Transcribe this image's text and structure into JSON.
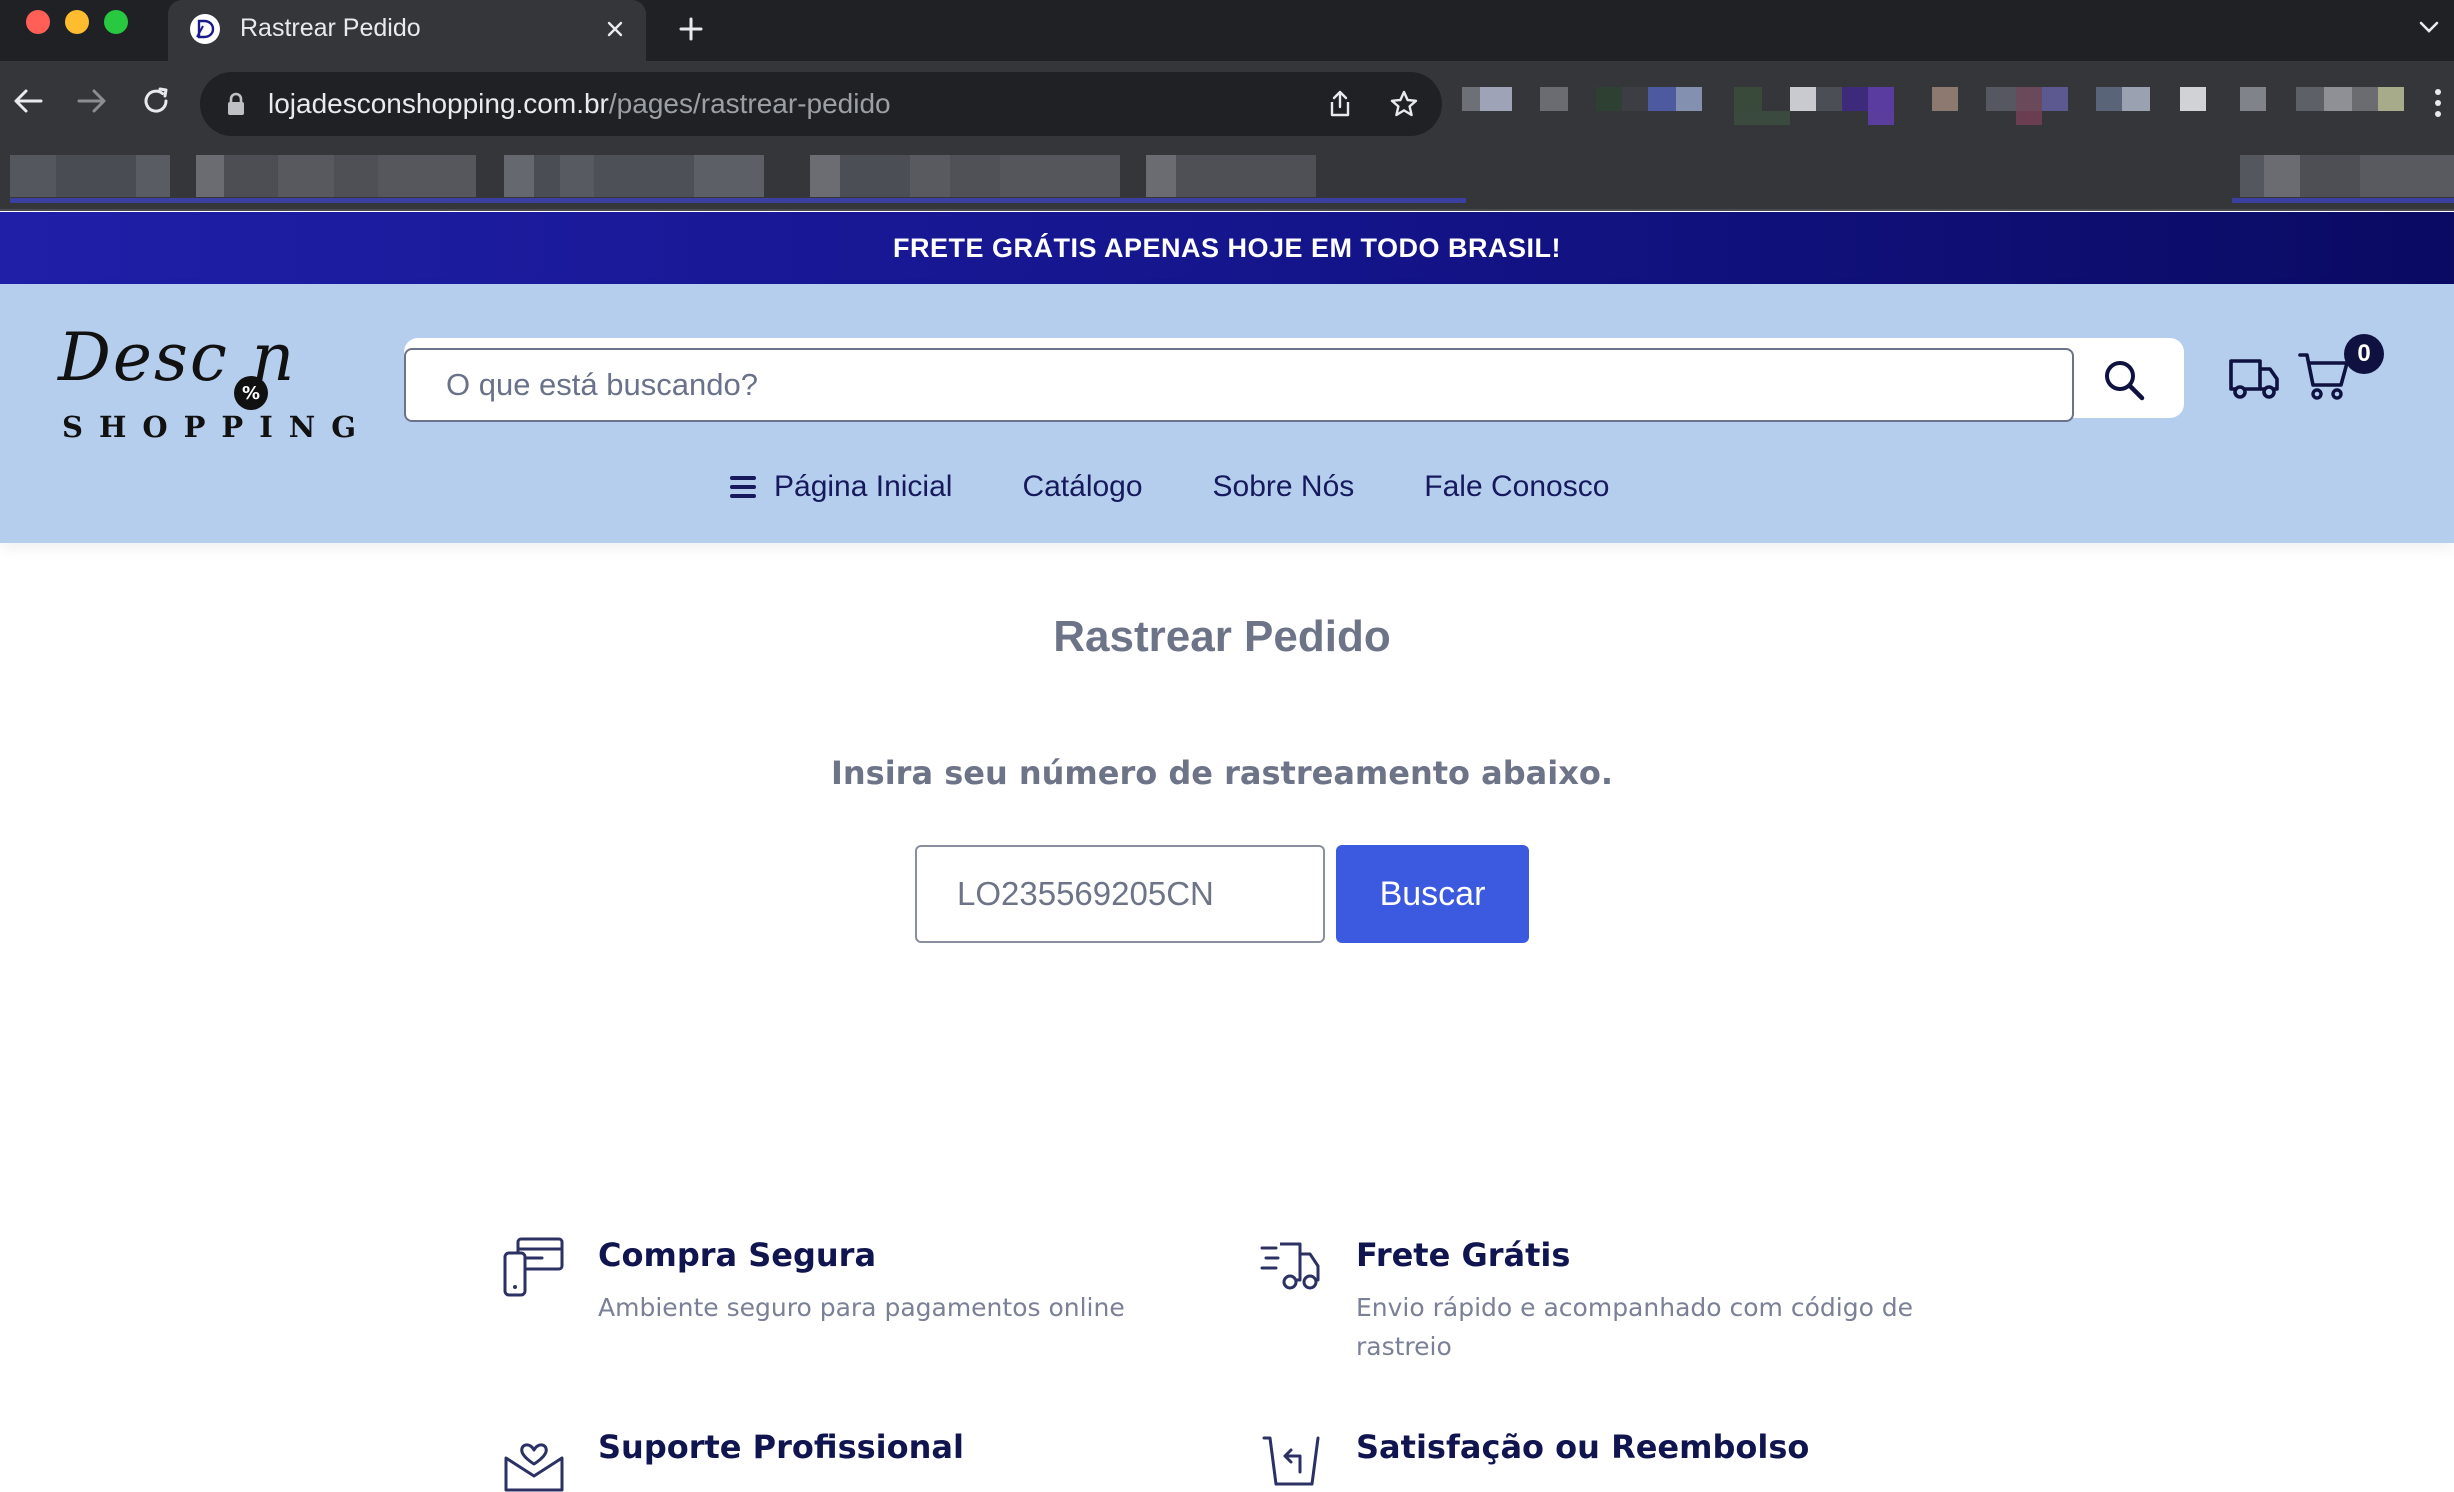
{
  "browser": {
    "tab_title": "Rastrear Pedido",
    "url_host": "lojadesconshopping.com.br",
    "url_path": "/pages/rastrear-pedido"
  },
  "promo": {
    "text": "FRETE GRÁTIS APENAS HOJE EM TODO BRASIL!"
  },
  "header": {
    "logo_script": "Desc n",
    "logo_badge": "%",
    "logo_sub": "SHOPPING",
    "search_placeholder": "O que está buscando?",
    "cart_count": "0"
  },
  "nav": {
    "items": [
      {
        "label": "Página Inicial"
      },
      {
        "label": "Catálogo"
      },
      {
        "label": "Sobre Nós"
      },
      {
        "label": "Fale Conosco"
      }
    ]
  },
  "tracking": {
    "title": "Rastrear Pedido",
    "instructions": "Insira seu número de rastreamento abaixo.",
    "input_value": "LO235569205CN",
    "button_label": "Buscar"
  },
  "features": [
    {
      "title": "Compra Segura",
      "description": "Ambiente seguro para pagamentos online",
      "icon": "secure-payment-icon"
    },
    {
      "title": "Frete Grátis",
      "description": "Envio rápido e acompanhado com código de rastreio",
      "icon": "fast-delivery-icon"
    },
    {
      "title": "Suporte Profissional",
      "description": "",
      "icon": "support-mail-icon"
    },
    {
      "title": "Satisfação ou Reembolso",
      "description": "",
      "icon": "refund-icon"
    }
  ],
  "colors": {
    "promo_bar": "#14148a",
    "header_bg": "#b6ceee",
    "nav_text": "#16195c",
    "primary_button": "#3b5ae0",
    "heading_gray": "#6e7488",
    "feature_title": "#11154f"
  }
}
